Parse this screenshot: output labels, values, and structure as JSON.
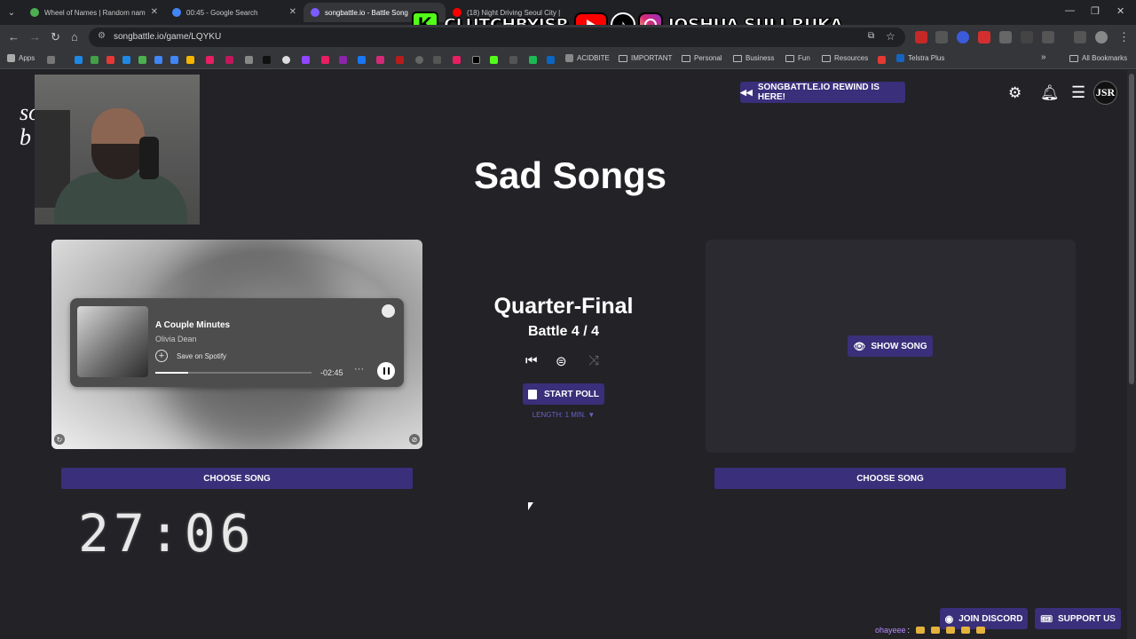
{
  "browser": {
    "tabs": [
      {
        "label": "Wheel of Names | Random nam",
        "color": "#4caf50"
      },
      {
        "label": "00:45 - Google Search",
        "color": "#4285f4"
      },
      {
        "label": "songbattle.io - Battle Song",
        "color": "#7b5cff"
      },
      {
        "label": "(18) Night Driving Seoul City |",
        "color": "#ff0000"
      }
    ],
    "url": "songbattle.io/game/LQYKU",
    "bookmarks": {
      "apps": "Apps",
      "acidbite": "ACIDBITE",
      "important": "IMPORTANT",
      "personal": "Personal",
      "business": "Business",
      "fun": "Fun",
      "resources": "Resources",
      "telstra": "Telstra Plus",
      "all": "All Bookmarks"
    }
  },
  "overlay": {
    "kick_name": "CLUTCHBYJSR",
    "social_name": "JOSHUA SULI-RUKA"
  },
  "site": {
    "logo_line1": "so",
    "logo_line2": "b",
    "rewind": "SONGBATTLE.IO REWIND IS HERE!",
    "avatar": "JSR"
  },
  "game": {
    "title": "Sad Songs",
    "round": "Quarter-Final",
    "battle": "Battle 4 / 4",
    "start_poll": "START POLL",
    "length": "LENGTH: 1 MIN. ▼",
    "show_song": "SHOW SONG",
    "choose_left": "CHOOSE SONG",
    "choose_right": "CHOOSE SONG",
    "timer": "27:06"
  },
  "player": {
    "song": "A Couple Minutes",
    "artist": "Olivia Dean",
    "save": "Save on Spotify",
    "remaining": "-02:45",
    "progress": 0.21
  },
  "footer": {
    "discord": "JOIN DISCORD",
    "support": "SUPPORT US",
    "chat_user": "ohayeee",
    "chat_sep": ":"
  },
  "colors": {
    "accent": "#3a2f7a",
    "background": "#232227"
  }
}
